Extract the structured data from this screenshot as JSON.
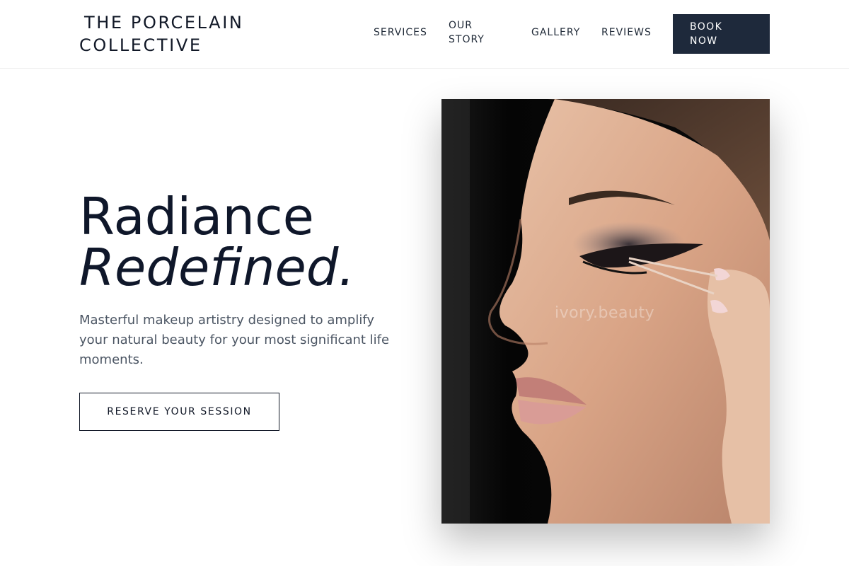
{
  "brand": {
    "line1": "THE PORCELAIN",
    "line2": "COLLECTIVE"
  },
  "nav": {
    "services": "SERVICES",
    "our_story_1": "OUR",
    "our_story_2": "STORY",
    "gallery": "GALLERY",
    "reviews": "REVIEWS",
    "book_1": "BOOK",
    "book_2": "NOW"
  },
  "hero": {
    "title_line1": "Radiance",
    "title_line2": "Redefined.",
    "description": "Masterful makeup artistry designed to amplify your natural beauty for your most significant life moments.",
    "cta": "RESERVE YOUR SESSION"
  },
  "image": {
    "watermark": "ivory.beauty"
  },
  "colors": {
    "primary_dark": "#1e293b",
    "text": "#0f172a",
    "muted": "#4b5563"
  }
}
